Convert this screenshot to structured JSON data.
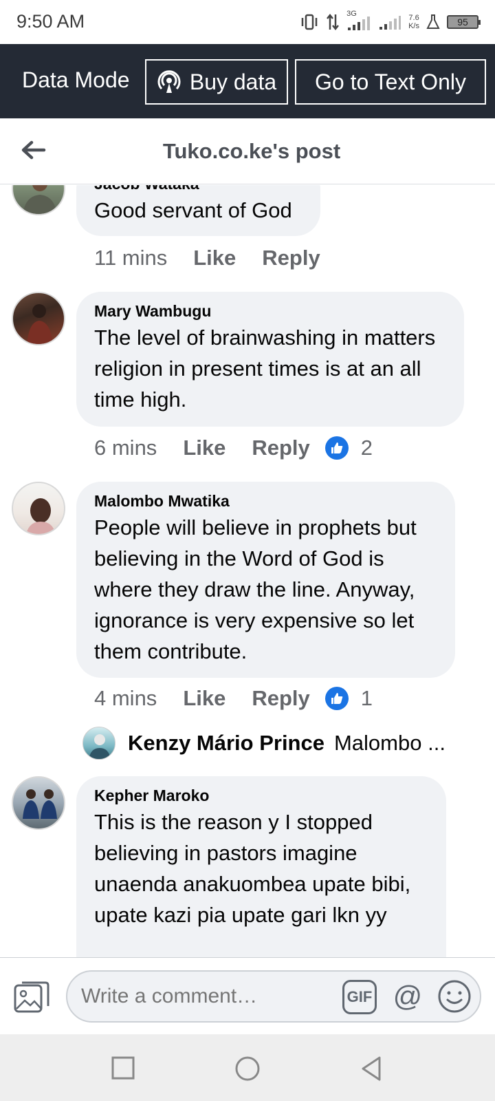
{
  "status_bar": {
    "time": "9:50 AM",
    "net_speed_value": "7.6",
    "net_speed_unit": "K/s",
    "network_type": "3G",
    "battery": "95"
  },
  "data_bar": {
    "mode_label": "Data Mode",
    "buy_data_label": "Buy data",
    "text_only_label": "Go to Text Only"
  },
  "header": {
    "title": "Tuko.co.ke's post"
  },
  "comments": [
    {
      "author": "Jacob Wataka",
      "text": "Good servant of God",
      "time": "11 mins",
      "like_label": "Like",
      "reply_label": "Reply",
      "reactions": ""
    },
    {
      "author": "Mary Wambugu",
      "text": "The level of brainwashing in matters religion in present times is at an all time high.",
      "time": "6 mins",
      "like_label": "Like",
      "reply_label": "Reply",
      "reactions": "2"
    },
    {
      "author": "Malombo Mwatika",
      "text": "People will believe in prophets but believing in the Word of God is where they draw the line. Anyway, ignorance is very expensive so let them contribute.",
      "time": "4 mins",
      "like_label": "Like",
      "reply_label": "Reply",
      "reactions": "1"
    },
    {
      "author": "Kepher Maroko",
      "text": "This is the reason y I stopped believing in pastors imagine unaenda anakuombea upate bibi, upate kazi pia upate gari lkn  yy"
    }
  ],
  "reply_preview": {
    "name": "Kenzy Mário Prince",
    "snippet": "Malombo ..."
  },
  "composer": {
    "placeholder": "Write a comment…",
    "gif_label": "GIF",
    "at_label": "@"
  },
  "colors": {
    "data_bar_bg": "#242a35",
    "bubble_bg": "#f0f2f5",
    "like_blue": "#1b74e4",
    "secondary_text": "#65676b"
  },
  "icons": {
    "back": "arrow-left-icon",
    "buy_data": "broadcast-icon",
    "like": "thumbs-up-icon",
    "photo": "photo-icon",
    "emoji": "smiley-icon"
  }
}
